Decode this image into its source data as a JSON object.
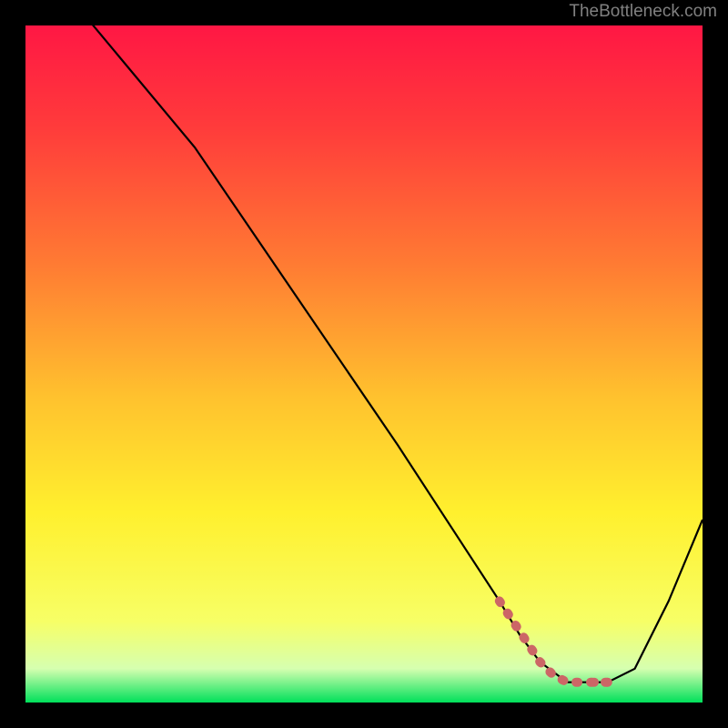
{
  "watermark": "TheBottleneck.com",
  "chart_data": {
    "type": "line",
    "title": "",
    "xlabel": "",
    "ylabel": "",
    "xlim": [
      0,
      100
    ],
    "ylim": [
      0,
      100
    ],
    "series": [
      {
        "name": "curve",
        "x": [
          0,
          10,
          25,
          40,
          55,
          70,
          73,
          76,
          80,
          84,
          86,
          90,
          95,
          100
        ],
        "y": [
          115,
          100,
          82,
          60,
          38,
          15,
          10,
          6,
          3,
          3,
          3,
          5,
          15,
          27
        ]
      }
    ],
    "highlight": {
      "name": "highlight-region",
      "x": [
        70,
        72,
        74,
        76,
        78,
        80,
        82,
        84,
        86
      ],
      "y": [
        15,
        12,
        9,
        6,
        4,
        3,
        3,
        3,
        3
      ]
    },
    "gradient_stops": [
      {
        "offset": 0.0,
        "color": "#ff1744"
      },
      {
        "offset": 0.15,
        "color": "#ff3b3b"
      },
      {
        "offset": 0.35,
        "color": "#ff7a33"
      },
      {
        "offset": 0.55,
        "color": "#ffc22e"
      },
      {
        "offset": 0.72,
        "color": "#fff02e"
      },
      {
        "offset": 0.88,
        "color": "#f7ff66"
      },
      {
        "offset": 0.95,
        "color": "#d6ffb0"
      },
      {
        "offset": 1.0,
        "color": "#00e05a"
      }
    ],
    "colors": {
      "curve": "#000000",
      "highlight": "#cc6666"
    }
  }
}
